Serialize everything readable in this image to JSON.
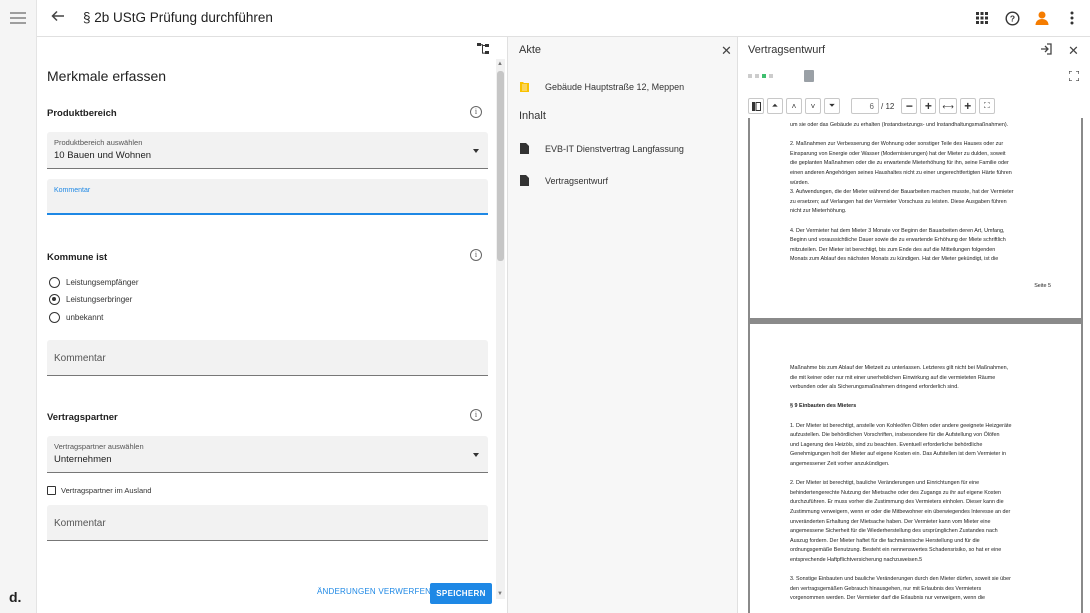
{
  "header": {
    "title": "§ 2b UStG Prüfung durchführen"
  },
  "form": {
    "heading": "Merkmale erfassen",
    "produktbereich": {
      "title": "Produktbereich",
      "select_label": "Produktbereich auswählen",
      "select_value": "10 Bauen und Wohnen",
      "comment_label": "Kommentar"
    },
    "kommune": {
      "title": "Kommune ist",
      "options": [
        "Leistungsempfänger",
        "Leistungserbringer",
        "unbekannt"
      ],
      "selected_index": 1,
      "comment_placeholder": "Kommentar"
    },
    "vertragspartner": {
      "title": "Vertragspartner",
      "select_label": "Vertragspartner auswählen",
      "select_value": "Unternehmen",
      "checkbox_label": "Vertragspartner im Ausland",
      "comment_placeholder": "Kommentar"
    },
    "buttons": {
      "discard": "ÄNDERUNGEN VERWERFEN",
      "save": "SPEICHERN"
    }
  },
  "akte": {
    "title": "Akte",
    "folder": "Gebäude Hauptstraße 12, Meppen",
    "inhalt_title": "Inhalt",
    "documents": [
      "EVB-IT Dienstvertrag Langfassung",
      "Vertragsentwurf"
    ]
  },
  "viewer": {
    "title": "Vertragsentwurf",
    "current_page": "6",
    "total_pages": "/ 12",
    "page1_lines": [
      "um sie oder das Gebäude zu erhalten (Instandsetzungs- und Instandhaltungsmaßnahmen).",
      "",
      "2. Maßnahmen zur Verbesserung der Wohnung oder sonstiger Teile des Hauses oder zur",
      "Einsparung von Energie oder Wasser (Modernisierungen) hat der Mieter zu dulden, soweit",
      "die geplanten Maßnahmen oder die zu erwartende Mieterhöhung für ihn, seine Familie oder",
      "einen anderen Angehörigen seines Haushaltes nicht zu einer ungerechtfertigten Härte führen",
      "würden.",
      "3. Aufwendungen, die der Mieter während der Bauarbeiten machen musste, hat der Vermieter",
      "zu ersetzen; auf Verlangen hat der Vermieter Vorschuss zu leisten. Diese Ausgaben führen",
      "nicht zur Mieterhöhung.",
      "",
      "4. Der Vermieter hat dem Mieter 3 Monate vor Beginn der Bauarbeiten deren Art, Umfang,",
      "Beginn und voraussichtliche Dauer sowie die zu erwartende Erhöhung der Miete schriftlich",
      "mitzuteilen. Der Mieter ist berechtigt, bis zum Ende des auf die Mitteilungen folgenden",
      "Monats zum Ablauf des nächsten Monats zu kündigen. Hat der Mieter gekündigt, ist die"
    ],
    "page1_footer": "Seite 5",
    "page2_lines": [
      "Maßnahme bis zum Ablauf der Mietzeit zu unterlassen. Letzteres gilt nicht bei Maßnahmen,",
      "die mit keiner oder nur mit einer unerheblichen Einwirkung auf die vermieteten Räume",
      "verbunden oder als Sicherungsmaßnahmen dringend erforderlich sind.",
      ""
    ],
    "page2_heading": "§ 9 Einbauten des Mieters",
    "page2_lines_b": [
      "1. Der Mieter ist berechtigt, anstelle von Kohleöfen Ölöfen oder andere geeignete Heizgeräte",
      "aufzustellen. Die behördlichen Vorschriften, insbesondere für die Aufstellung von Ölöfen",
      "und Lagerung des Heizöls, sind zu beachten. Eventuell erforderliche behördliche",
      "Genehmigungen holt der Mieter auf eigene Kosten ein. Das Aufstellen ist dem Vermieter in",
      "angemessener Zeit vorher anzukündigen.",
      "",
      "2. Der Mieter ist berechtigt, bauliche Veränderungen und Einrichtungen für eine",
      "behindertengerechte Nutzung der Mietsache oder des Zugangs zu ihr auf eigene Kosten",
      "durchzuführen. Er muss vorher die Zustimmung des Vermieters einholen. Dieser kann die",
      "Zustimmung verweigern, wenn er oder die Mitbewohner ein überwiegendes Interesse an der",
      "unveränderten Erhaltung der Mietsache haben. Der Vermieter kann vom Mieter eine",
      "angemessene Sicherheit für die Wiederherstellung des ursprünglichen Zustandes nach",
      "Auszug fordern. Der Mieter haftet für die fachmännische Herstellung und für die",
      "ordnungsgemäße Benutzung. Besteht ein nennenswertes Schadensrisiko, so hat er eine",
      "entsprechende Haftpflichtversicherung nachzuweisen.5",
      "",
      "3. Sonstige Einbauten und bauliche Veränderungen durch den Mieter dürfen, soweit sie über",
      "den vertragsgemäßen Gebrauch hinausgehen, nur mit Erlaubnis des Vermieters",
      "vorgenommen werden. Der Vermieter darf die Erlaubnis nur verweigern, wenn die"
    ]
  },
  "rail": {
    "logo": "d."
  },
  "colors": {
    "accent": "#1e88e5",
    "avatar": "#f57c00",
    "folder": "#f9c200"
  }
}
